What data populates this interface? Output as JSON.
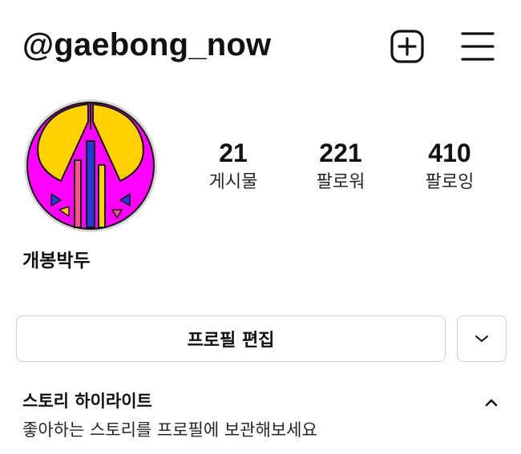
{
  "header": {
    "username": "@gaebong_now",
    "add_icon": "plus-square-icon",
    "menu_icon": "hamburger-menu-icon"
  },
  "profile": {
    "display_name": "개봉박두",
    "avatar_colors": {
      "background": "#ff00ff",
      "yellow": "#ffd200",
      "blue": "#1f3ad6",
      "pink": "#ff4f8b",
      "outline": "#111111"
    },
    "stats": {
      "posts": {
        "count": "21",
        "label": "게시물"
      },
      "followers": {
        "count": "221",
        "label": "팔로워"
      },
      "following": {
        "count": "410",
        "label": "팔로잉"
      }
    }
  },
  "actions": {
    "edit_profile_label": "프로필 편집",
    "dropdown_icon": "chevron-down-icon"
  },
  "highlights": {
    "title": "스토리 하이라이트",
    "description": "좋아하는 스토리를 프로필에 보관해보세요",
    "toggle_icon": "chevron-up-icon"
  }
}
